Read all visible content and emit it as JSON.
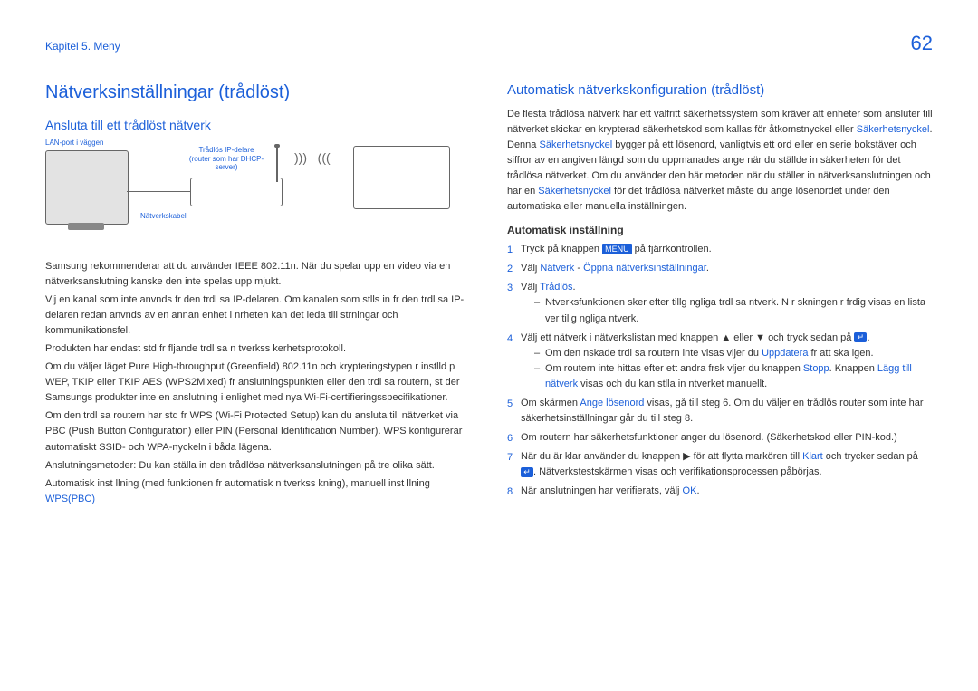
{
  "header": {
    "breadcrumb": "Kapitel 5. Meny",
    "page_number": "62"
  },
  "left": {
    "title": "Nätverksinställningar (trådlöst)",
    "subtitle": "Ansluta till ett trådlöst nätverk",
    "diagram": {
      "lan_port": "LAN-port i väggen",
      "router_label_1": "Trådlös IP-delare",
      "router_label_2": "(router som har DHCP-",
      "router_label_3": "server)",
      "cable": "Nätverkskabel"
    },
    "p1": "Samsung rekommenderar att du använder IEEE 802.11n. När du spelar upp en video via en nätverksanslutning kanske den inte spelas upp mjukt.",
    "p2": "Vlj en kanal som inte anvnds fr den trdl sa IP-delaren. Om kanalen som stlls in fr den trdl sa IP-delaren redan anvnds av en annan enhet i nrheten kan det leda till strningar och kommunikationsfel.",
    "p3": "Produkten har endast std fr fljande trdl sa n tverkss kerhetsprotokoll.",
    "p4": "Om du väljer läget Pure High-throughput (Greenfield) 802.11n och krypteringstypen r instlld p WEP, TKIP eller TKIP AES (WPS2Mixed) fr anslutningspunkten eller den trdl sa routern, st der Samsungs produkter inte en anslutning i enlighet med nya Wi-Fi-certifieringsspecifikationer.",
    "p5": "Om den trdl sa routern har std fr WPS (Wi-Fi Protected Setup) kan du ansluta till nätverket via PBC (Push Button Configuration) eller PIN (Personal Identification Number). WPS konfigurerar automatiskt SSID- och WPA-nyckeln i båda lägena.",
    "p6": "Anslutningsmetoder: Du kan ställa in den trådlösa nätverksanslutningen på tre olika sätt.",
    "p7_a": "Automatisk inst llning (med funktionen fr automatisk n tverkss kning), manuell inst llning",
    "p7_b": "WPS(PBC)"
  },
  "right": {
    "title": "Automatisk nätverkskonfiguration (trådlöst)",
    "intro_a": "De flesta trådlösa nätverk har ett valfritt säkerhetssystem som kräver att enheter som ansluter till nätverket skickar en krypterad säkerhetskod som kallas för åtkomstnyckel eller ",
    "intro_key1": "Säkerhetsnyckel",
    "intro_b": ". Denna ",
    "intro_key2": "Säkerhetsnyckel",
    "intro_c": " bygger på ett lösenord, vanligtvis ett ord eller en serie bokstäver och siffror av en angiven längd som du uppmanades ange när du ställde in säkerheten för det trådlösa nätverket. Om du använder den här metoden när du ställer in nätverksanslutningen och har en ",
    "intro_key3": "Säkerhetsnyckel",
    "intro_d": " för det trådlösa nätverket måste du ange lösenordet under den automatiska eller manuella inställningen.",
    "sub": "Automatisk inställning",
    "step1_a": "Tryck på knappen ",
    "step1_menu": "MENU",
    "step1_b": " på fjärrkontrollen.",
    "step2_a": "Välj ",
    "step2_link1": "Nätverk",
    "step2_sep": " - ",
    "step2_link2": "Öppna nätverksinställningar",
    "step2_b": ".",
    "step3_a": "Välj ",
    "step3_link": "Trådlös",
    "step3_b": ".",
    "step3_dash": "Ntverksfunktionen sker efter tillg ngliga trdl sa ntverk. N r skningen r frdig visas en lista ver tillg ngliga ntverk.",
    "step4": "Välj ett nätverk i nätverkslistan med knappen ▲ eller ▼ och tryck sedan på ",
    "step4_dash1_a": "Om den nskade trdl sa routern inte visas vljer du ",
    "step4_dash1_link": "Uppdatera",
    "step4_dash1_b": " fr att ska igen.",
    "step4_dash2_a": "Om routern inte hittas efter ett andra frsk vljer du knappen ",
    "step4_dash2_link": "Stopp",
    "step4_dash2_b": ". Knappen ",
    "step4_dash2_link2": "Lägg till nätverk",
    "step4_dash2_c": " visas och du kan stlla in ntverket manuellt.",
    "step5_a": "Om skärmen ",
    "step5_link": "Ange lösenord",
    "step5_b": " visas, gå till steg 6. Om du väljer en trådlös router som inte har säkerhetsinställningar går du till steg 8.",
    "step6": "Om routern har säkerhetsfunktioner anger du lösenord. (Säkerhetskod eller PIN-kod.)",
    "step7_a": "När du är klar använder du knappen ▶ för att flytta markören till ",
    "step7_link": "Klart",
    "step7_b": " och trycker sedan på ",
    "step7_c": ". Nätverkstestskärmen visas och verifikationsprocessen påbörjas.",
    "step8_a": "När anslutningen har verifierats, välj ",
    "step8_link": "OK",
    "step8_b": "."
  }
}
